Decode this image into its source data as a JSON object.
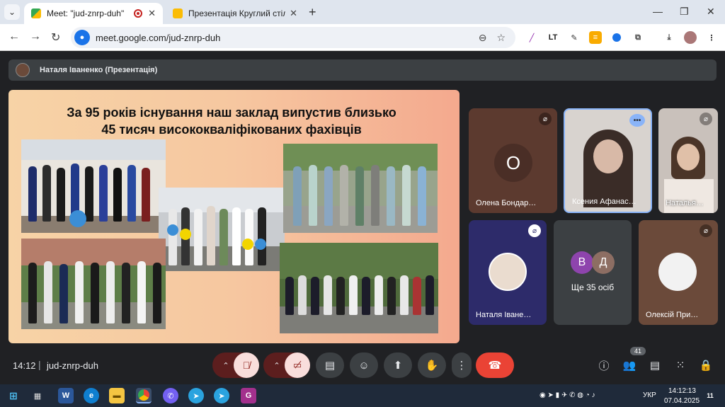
{
  "tabs": [
    {
      "title": "Meet: \"jud-znrp-duh\""
    },
    {
      "title": "Презентація Круглий стіл «Мо"
    }
  ],
  "address": {
    "url": "meet.google.com/jud-znrp-duh"
  },
  "presenter": {
    "name": "Наталя Іваненко (Презентація)"
  },
  "slide": {
    "title_line1": "За 95 років існування наш заклад випустив близько",
    "title_line2": "45 тисяч висококваліфікованих фахівців"
  },
  "participants": [
    {
      "name": "Олена Бондар…",
      "initial": "О"
    },
    {
      "name": "Ксения Афанас…"
    },
    {
      "name": "Наталья…"
    },
    {
      "name": "Наталя Іване…"
    },
    {
      "name": "Ще 35 осіб",
      "initials": [
        "В",
        "Д"
      ]
    },
    {
      "name": "Олексій При…"
    }
  ],
  "meeting": {
    "time": "14:12",
    "code": "jud-znrp-duh",
    "participant_count": "41"
  },
  "taskbar": {
    "lang": "УКР",
    "time": "14:12:13",
    "date": "07.04.2025",
    "notif": "11"
  },
  "colors": {
    "end_call": "#ea4335",
    "muted": "#f9dedc",
    "accent": "#1a73e8"
  }
}
